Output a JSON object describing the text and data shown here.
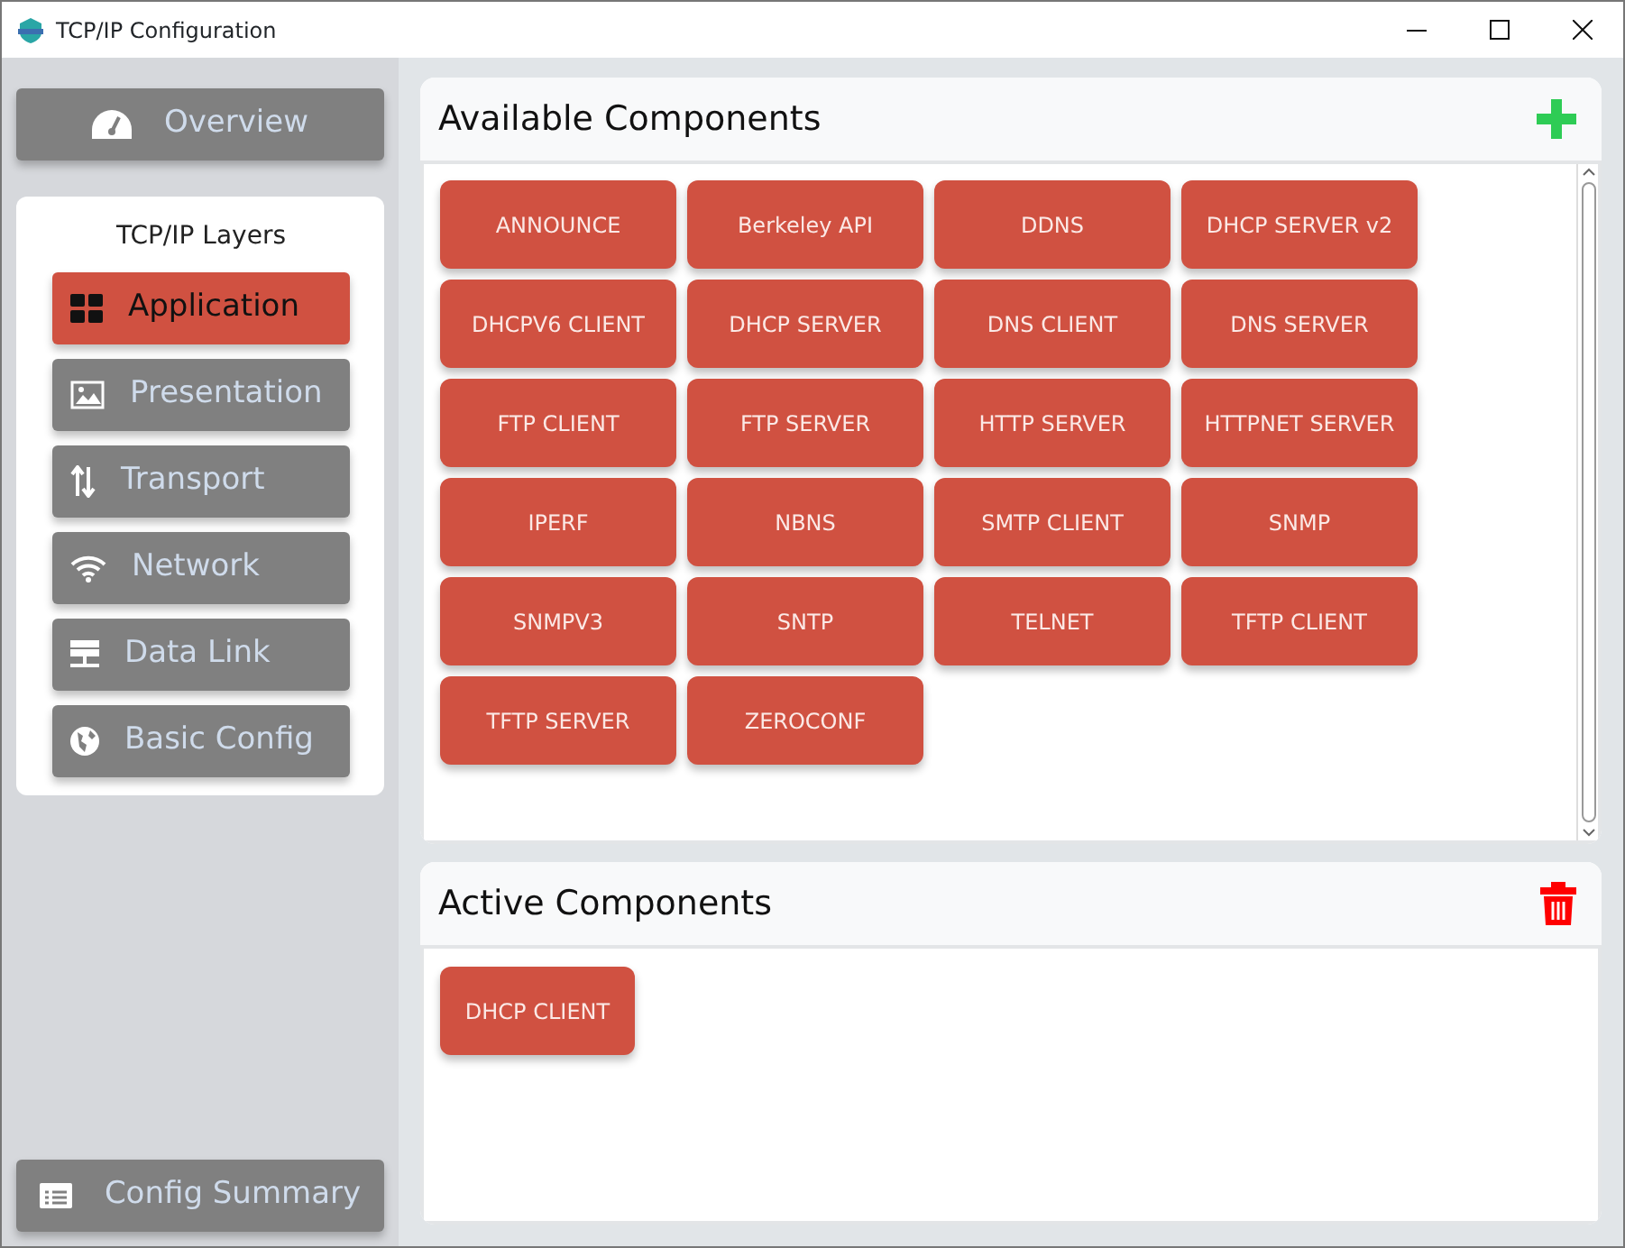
{
  "window": {
    "title": "TCP/IP Configuration"
  },
  "sidebar": {
    "overview": "Overview",
    "layers_title": "TCP/IP Layers",
    "layers": [
      {
        "label": "Application",
        "selected": true
      },
      {
        "label": "Presentation",
        "selected": false
      },
      {
        "label": "Transport",
        "selected": false
      },
      {
        "label": "Network",
        "selected": false
      },
      {
        "label": "Data Link",
        "selected": false
      },
      {
        "label": "Basic Config",
        "selected": false
      }
    ],
    "config_summary": "Config Summary"
  },
  "available": {
    "title": "Available Components",
    "components": [
      "ANNOUNCE",
      "Berkeley API",
      "DDNS",
      "DHCP SERVER v2",
      "DHCPV6 CLIENT",
      "DHCP SERVER",
      "DNS CLIENT",
      "DNS SERVER",
      "FTP CLIENT",
      "FTP SERVER",
      "HTTP SERVER",
      "HTTPNET SERVER",
      "IPERF",
      "NBNS",
      "SMTP CLIENT",
      "SNMP",
      "SNMPV3",
      "SNTP",
      "TELNET",
      "TFTP CLIENT",
      "TFTP SERVER",
      "ZEROCONF"
    ]
  },
  "active": {
    "title": "Active Components",
    "components": [
      "DHCP CLIENT"
    ]
  }
}
